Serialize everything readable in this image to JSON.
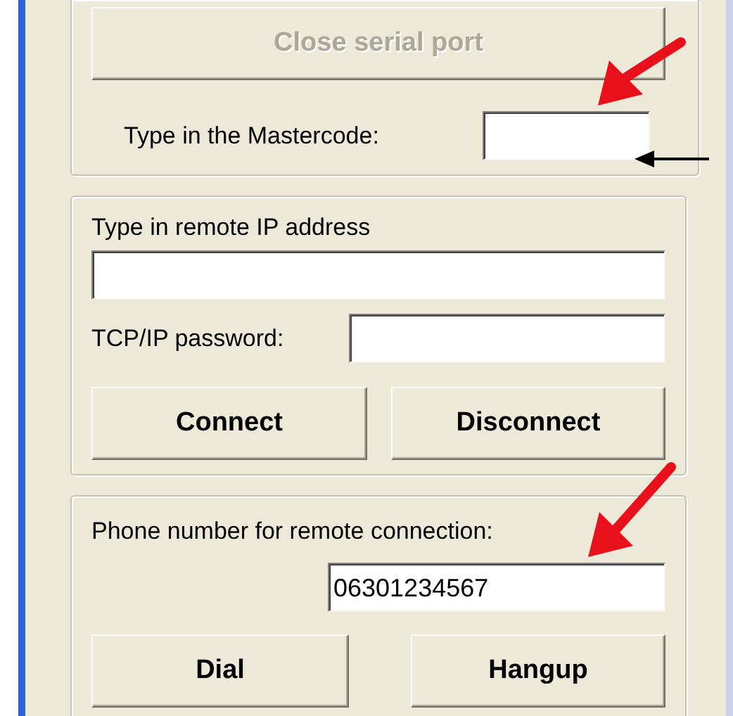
{
  "serial_group": {
    "close_button": {
      "label": "Close serial port",
      "disabled": true
    },
    "mastercode": {
      "label": "Type in the Mastercode:"
    }
  },
  "tcpip_group": {
    "ip_label": "Type in remote IP address",
    "password_label": "TCP/IP password:",
    "buttons": [
      {
        "label": "Connect"
      },
      {
        "label": "Disconnect"
      }
    ]
  },
  "phone_group": {
    "label": "Phone number for remote connection:",
    "phone": {
      "value": "06301234567"
    },
    "buttons": [
      {
        "label": "Dial"
      },
      {
        "label": "Hangup"
      }
    ]
  }
}
